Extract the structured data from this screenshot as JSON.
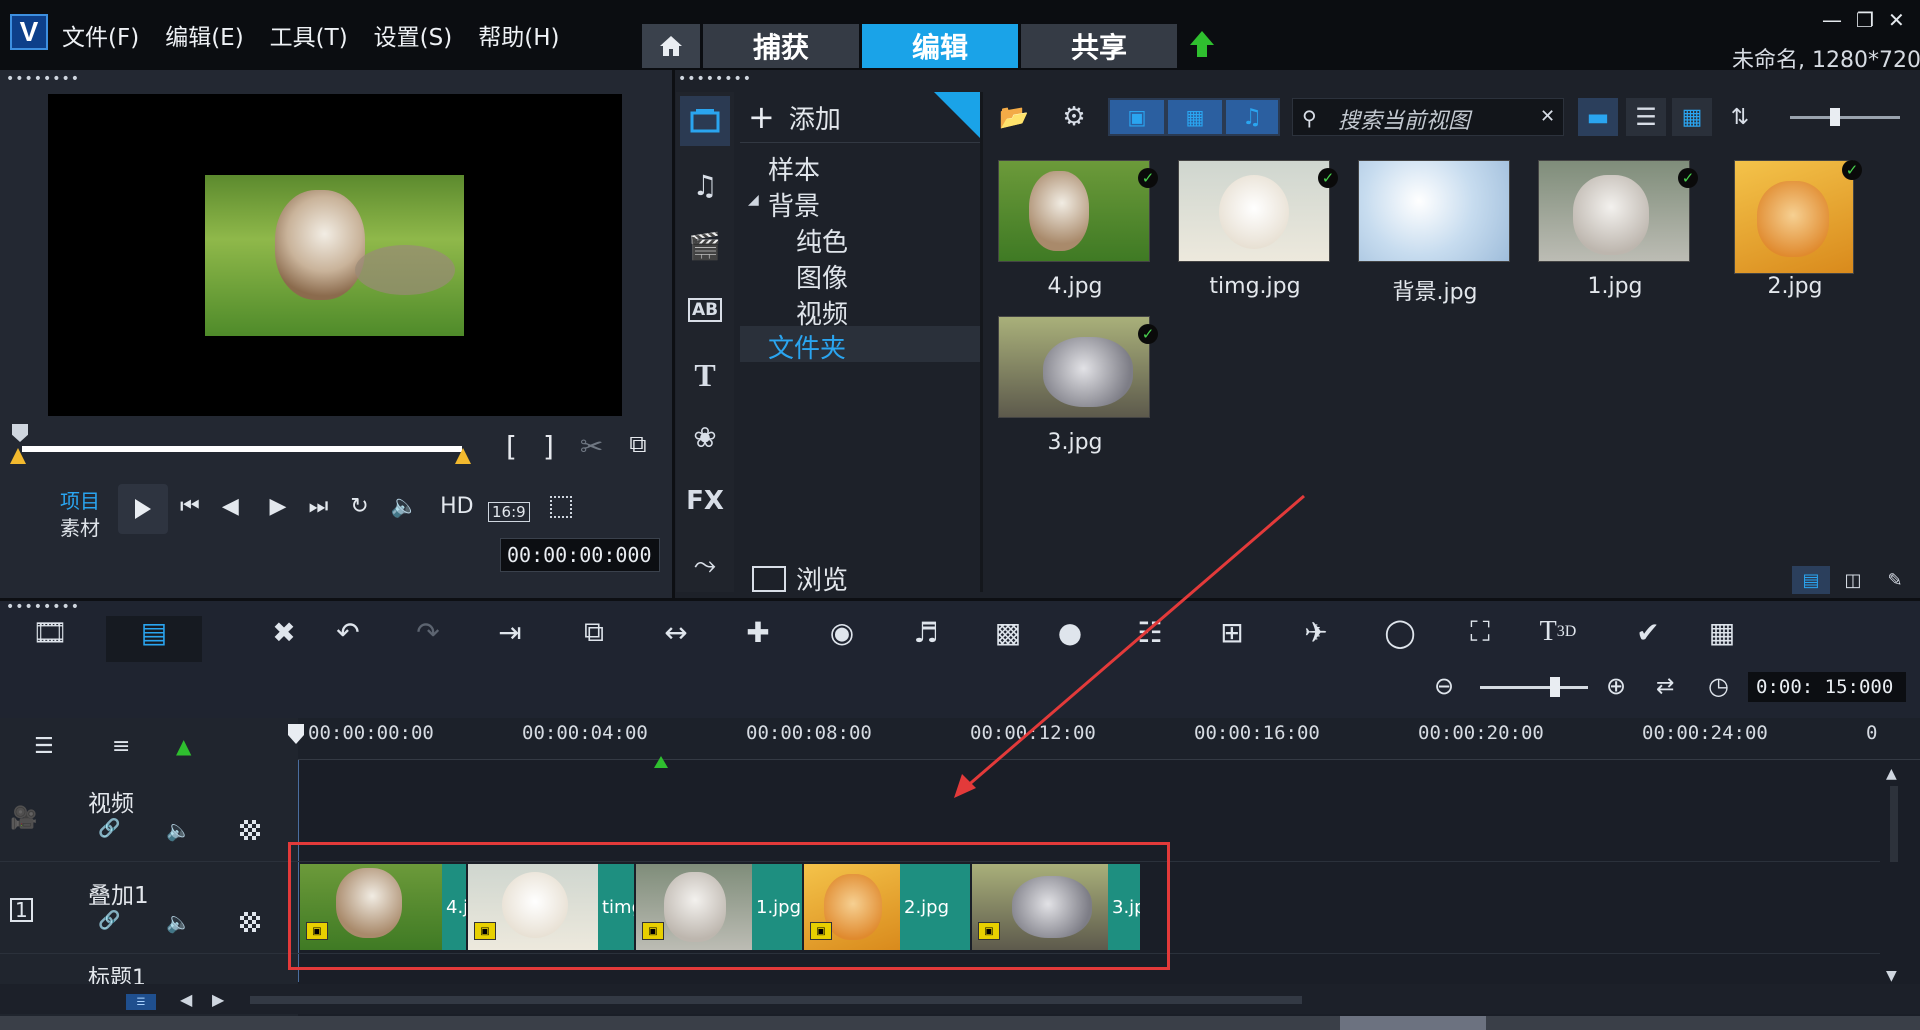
{
  "menubar": {
    "logo": "V",
    "items": [
      "文件(F)",
      "编辑(E)",
      "工具(T)",
      "设置(S)",
      "帮助(H)"
    ],
    "tabs": [
      "捕获",
      "编辑",
      "共享"
    ],
    "project_info": "未命名, 1280*720"
  },
  "player": {
    "mode_project": "项目",
    "mode_clip": "素材",
    "hd_label": "HD",
    "aspect": "16:9",
    "timecode": "00:00:00:000"
  },
  "library": {
    "add_label": "添加",
    "browse_label": "浏览",
    "tree": [
      "样本",
      "背景",
      "纯色",
      "图像",
      "视频",
      "文件夹"
    ],
    "fx_label": "FX",
    "search_placeholder": "搜索当前视图",
    "thumbnails": [
      {
        "name": "4.jpg",
        "checked": true
      },
      {
        "name": "timg.jpg",
        "checked": true
      },
      {
        "name": "背景.jpg",
        "checked": false
      },
      {
        "name": "1.jpg",
        "checked": true
      },
      {
        "name": "2.jpg",
        "checked": true
      },
      {
        "name": "3.jpg",
        "checked": true
      }
    ]
  },
  "timeline": {
    "zoom_timecode": "0:00: 15:000",
    "ruler": [
      "00:00:00:00",
      "00:00:04:00",
      "00:00:08:00",
      "00:00:12:00",
      "00:00:16:00",
      "00:00:20:00",
      "00:00:24:00",
      "0"
    ],
    "tracks": [
      {
        "name": "视频"
      },
      {
        "name": "叠加1"
      },
      {
        "name": "标题1"
      }
    ],
    "clips": [
      {
        "label": "4.j"
      },
      {
        "label": "timg"
      },
      {
        "label": "1.jpg"
      },
      {
        "label": "2.jpg"
      },
      {
        "label": "3.jp"
      }
    ]
  },
  "colors": {
    "accent_blue": "#1aa3e8",
    "clip_teal": "#1e8f80",
    "highlight_red": "#e33a3a",
    "check_green": "#49d14e"
  }
}
